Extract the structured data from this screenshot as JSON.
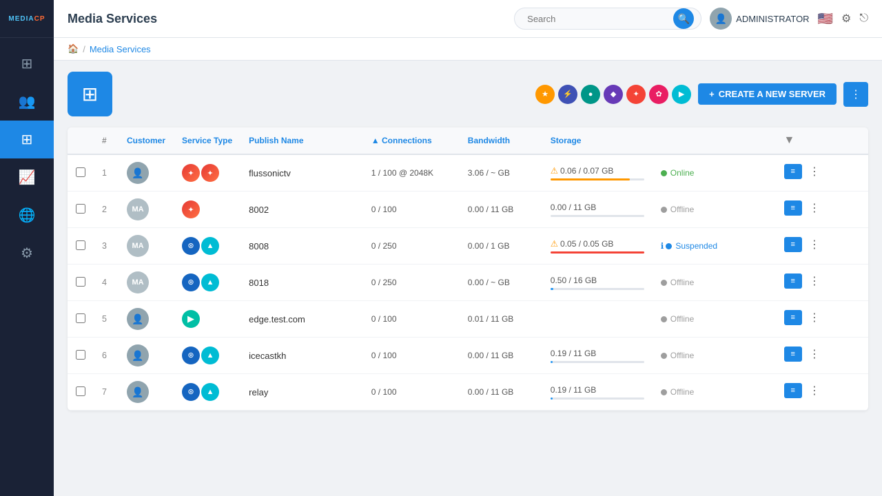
{
  "app": {
    "logo": "MEDIACP",
    "logo_dot": "●"
  },
  "topbar": {
    "title": "Media Services",
    "search_placeholder": "Search",
    "admin_label": "ADMINISTRATOR",
    "flag": "🇺🇸"
  },
  "breadcrumb": {
    "home": "🏠",
    "separator": "/",
    "current": "Media Services"
  },
  "toolbar": {
    "create_button": "CREATE A NEW SERVER",
    "more_icon": "⋮"
  },
  "table": {
    "columns": [
      "#",
      "Customer",
      "Service Type",
      "Publish Name",
      "Connections",
      "Bandwidth",
      "Storage",
      "",
      "",
      ""
    ],
    "conn_sort_icon": "▲",
    "filter_icon": "▼"
  },
  "sidebar": {
    "items": [
      {
        "icon": "⊞",
        "label": "dashboard",
        "active": false
      },
      {
        "icon": "👥",
        "label": "users",
        "active": false
      },
      {
        "icon": "⊞",
        "label": "media-services",
        "active": true
      },
      {
        "icon": "📈",
        "label": "analytics",
        "active": false
      },
      {
        "icon": "🌐",
        "label": "network",
        "active": false
      },
      {
        "icon": "⚙",
        "label": "settings",
        "active": false
      }
    ]
  },
  "service_icons": [
    {
      "bg": "#ff9800",
      "char": "★",
      "label": "icon-1"
    },
    {
      "bg": "#3f51b5",
      "char": "⚡",
      "label": "icon-2"
    },
    {
      "bg": "#009688",
      "char": "●",
      "label": "icon-3"
    },
    {
      "bg": "#673ab7",
      "char": "◆",
      "label": "icon-4"
    },
    {
      "bg": "#f44336",
      "char": "✦",
      "label": "icon-5"
    },
    {
      "bg": "#e91e63",
      "char": "✿",
      "label": "icon-6"
    },
    {
      "bg": "#00bcd4",
      "char": "▶",
      "label": "icon-7"
    }
  ],
  "rows": [
    {
      "id": 1,
      "customer_type": "photo",
      "customer_initials": "",
      "svc_icons": [
        "red-wave",
        "red-wave"
      ],
      "publish_name": "flussonictv",
      "connections": "1 / 100 @ 2048K",
      "bandwidth": "3.06 / ~ GB",
      "storage": "0.06 / 0.07 GB",
      "storage_pct": 85,
      "storage_color": "fill-orange",
      "storage_class": "storage-warning",
      "status": "Online",
      "status_class": "status-online",
      "status_dot": "dot-green",
      "status_icon": ""
    },
    {
      "id": 2,
      "customer_type": "initials",
      "customer_initials": "MA",
      "svc_icons": [
        "red-wave"
      ],
      "publish_name": "8002",
      "connections": "0 / 100",
      "bandwidth": "0.00 / 11 GB",
      "storage": "0.00 / 11 GB",
      "storage_pct": 0,
      "storage_color": "fill-green",
      "storage_class": "storage-normal",
      "status": "Offline",
      "status_class": "status-offline",
      "status_dot": "dot-grey",
      "status_icon": ""
    },
    {
      "id": 3,
      "customer_type": "initials",
      "customer_initials": "MA",
      "svc_icons": [
        "dark-blue",
        "teal-circle"
      ],
      "publish_name": "8008",
      "connections": "0 / 250",
      "bandwidth": "0.00 / 1 GB",
      "storage": "0.05 / 0.05 GB",
      "storage_pct": 100,
      "storage_color": "fill-red",
      "storage_class": "storage-warning",
      "status": "Suspended",
      "status_class": "status-suspended",
      "status_dot": "dot-blue",
      "status_icon": "info"
    },
    {
      "id": 4,
      "customer_type": "initials",
      "customer_initials": "MA",
      "svc_icons": [
        "dark-blue",
        "teal-circle"
      ],
      "publish_name": "8018",
      "connections": "0 / 250",
      "bandwidth": "0.00 / ~ GB",
      "storage": "0.50 / 16 GB",
      "storage_pct": 3,
      "storage_color": "fill-blue",
      "storage_class": "storage-normal",
      "status": "Offline",
      "status_class": "status-offline",
      "status_dot": "dot-grey",
      "status_icon": ""
    },
    {
      "id": 5,
      "customer_type": "photo",
      "customer_initials": "",
      "svc_icons": [
        "play-teal"
      ],
      "publish_name": "edge.test.com",
      "connections": "0 / 100",
      "bandwidth": "0.01 / 11 GB",
      "storage": "",
      "storage_pct": 0,
      "storage_color": "fill-green",
      "storage_class": "storage-normal",
      "status": "Offline",
      "status_class": "status-offline",
      "status_dot": "dot-grey",
      "status_icon": ""
    },
    {
      "id": 6,
      "customer_type": "photo",
      "customer_initials": "",
      "svc_icons": [
        "dark-blue",
        "teal-circle"
      ],
      "publish_name": "icecastkh",
      "connections": "0 / 100",
      "bandwidth": "0.00 / 11 GB",
      "storage": "0.19 / 11 GB",
      "storage_pct": 2,
      "storage_color": "fill-blue",
      "storage_class": "storage-normal",
      "status": "Offline",
      "status_class": "status-offline",
      "status_dot": "dot-grey",
      "status_icon": ""
    },
    {
      "id": 7,
      "customer_type": "photo",
      "customer_initials": "",
      "svc_icons": [
        "dark-blue",
        "teal-circle"
      ],
      "publish_name": "relay",
      "connections": "0 / 100",
      "bandwidth": "0.00 / 11 GB",
      "storage": "0.19 / 11 GB",
      "storage_pct": 2,
      "storage_color": "fill-blue",
      "storage_class": "storage-normal",
      "status": "Offline",
      "status_class": "status-offline",
      "status_dot": "dot-grey",
      "status_icon": ""
    }
  ]
}
